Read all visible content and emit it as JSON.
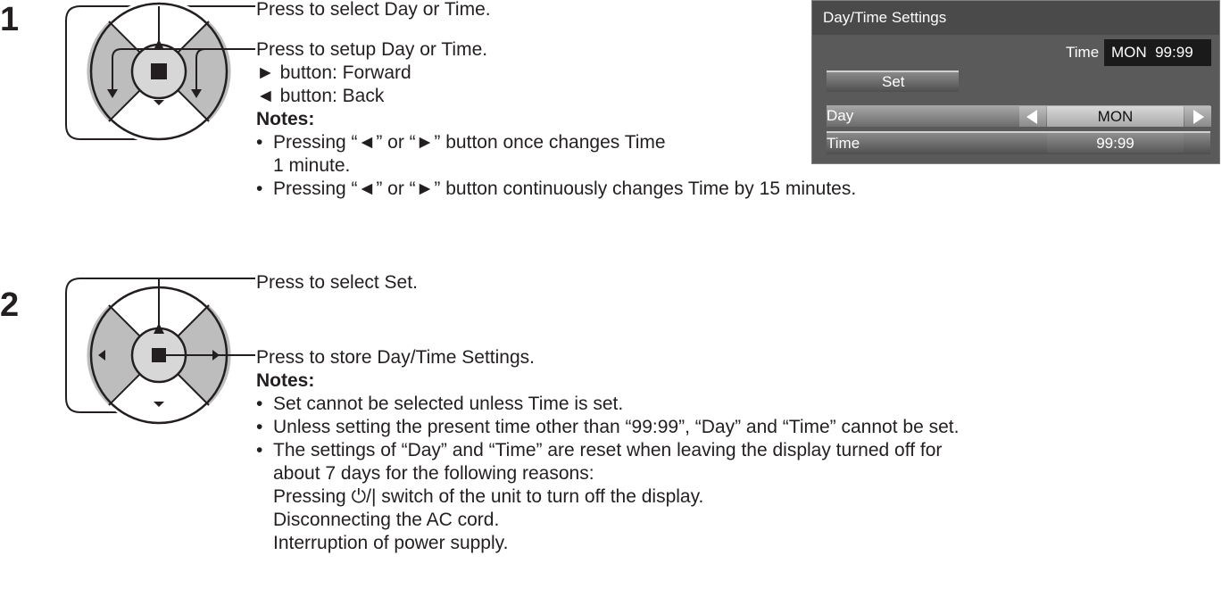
{
  "steps": [
    {
      "number": "1",
      "line1": "Press to select Day or Time.",
      "line2": "Press to setup Day or Time.",
      "fwd": "► button: Forward",
      "back": "◄ button: Back",
      "notes_heading": "Notes:",
      "notes": [
        "Pressing “◄” or “►” button once changes Time",
        "1 minute.",
        "Pressing “◄” or “►” button continuously changes Time by 15 minutes."
      ]
    },
    {
      "number": "2",
      "line1": "Press to select Set.",
      "line2": "Press to store Day/Time Settings.",
      "notes_heading": "Notes:",
      "notes": [
        "Set cannot be selected unless Time is set.",
        "Unless setting the present time other than “99:99”, “Day” and “Time” cannot be set.",
        "The settings of “Day” and “Time” are reset when leaving the display turned off for",
        "about 7 days for the following reasons:",
        "Pressing ⏻/| switch of the unit to turn off the display.",
        "Disconnecting the AC cord.",
        "Interruption of power supply."
      ]
    }
  ],
  "menu": {
    "title": "Day/Time Settings",
    "time_label": "Time",
    "time_value": "MON  99:99",
    "set_label": "Set",
    "rows": [
      {
        "label": "Day",
        "value": "MON"
      },
      {
        "label": "Time",
        "value": "99:99"
      }
    ]
  }
}
